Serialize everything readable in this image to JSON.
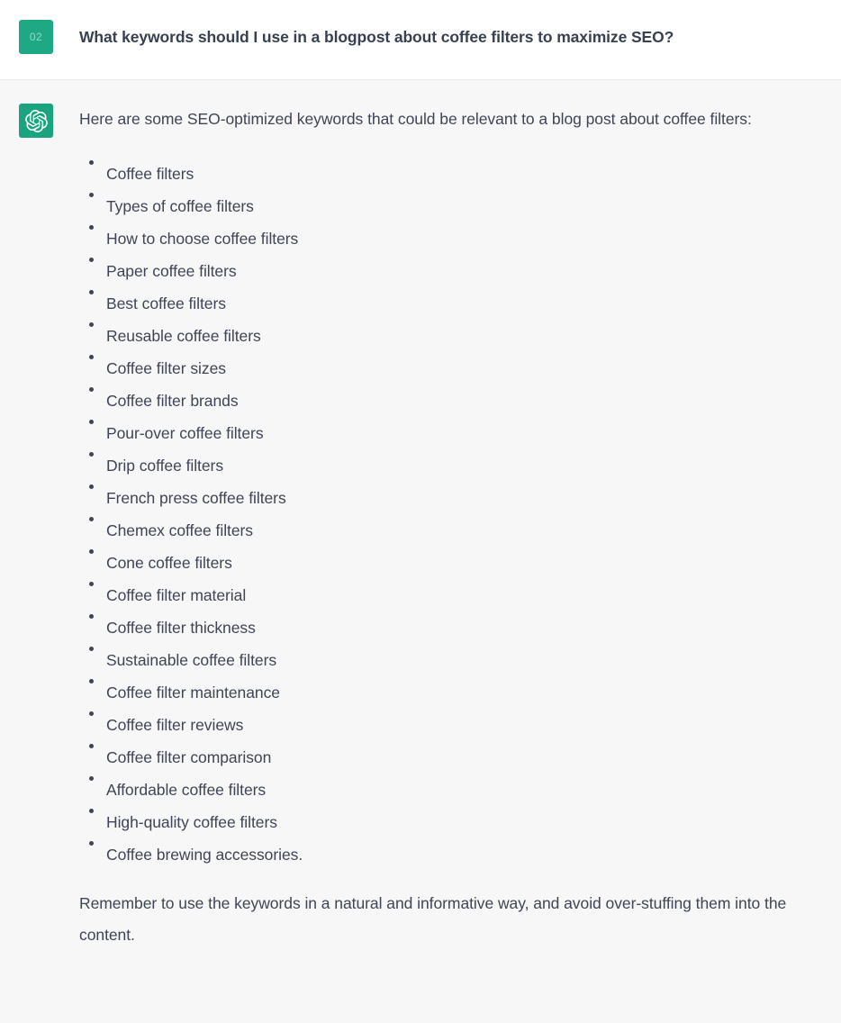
{
  "conversation": {
    "user_message": {
      "avatar_label": "02",
      "avatar_color": "#1fa884",
      "avatar_text_color": "#93dac5",
      "text": "What keywords should I use in a blogpost about coffee filters to maximize SEO?"
    },
    "assistant_message": {
      "avatar_icon": "openai-logo-icon",
      "avatar_color": "#19a37f",
      "intro_paragraph": "Here are some SEO-optimized keywords that could be relevant to a blog post about coffee filters:",
      "keywords": [
        "Coffee filters",
        "Types of coffee filters",
        "How to choose coffee filters",
        "Paper coffee filters",
        "Best coffee filters",
        "Reusable coffee filters",
        "Coffee filter sizes",
        "Coffee filter brands",
        "Pour-over coffee filters",
        "Drip coffee filters",
        "French press coffee filters",
        "Chemex coffee filters",
        "Cone coffee filters",
        "Coffee filter material",
        "Coffee filter thickness",
        "Sustainable coffee filters",
        "Coffee filter maintenance",
        "Coffee filter reviews",
        "Coffee filter comparison",
        "Affordable coffee filters",
        "High-quality coffee filters",
        "Coffee brewing accessories."
      ],
      "outro_paragraph": "Remember to use the keywords in a natural and informative way, and avoid over-stuffing them into the content."
    }
  },
  "theme": {
    "user_background": "#ffffff",
    "assistant_background": "#f7f7f8",
    "text_color": "#3f4555",
    "divider_color": "#ebebeb"
  }
}
